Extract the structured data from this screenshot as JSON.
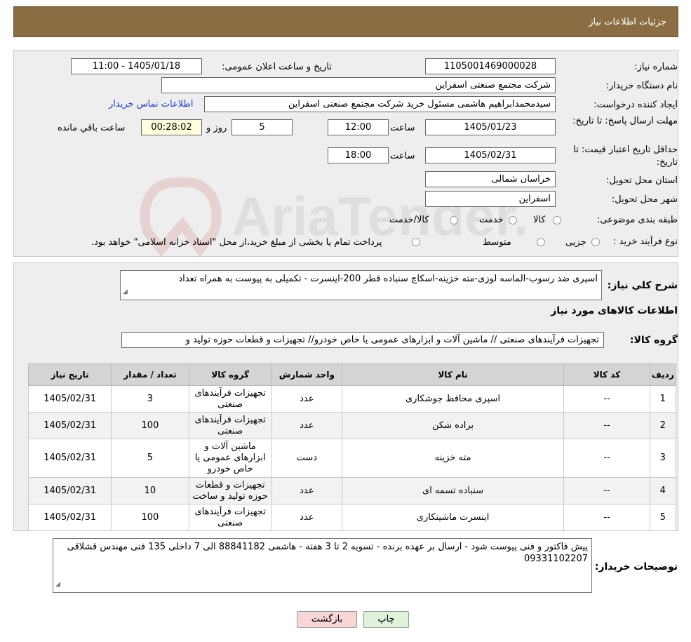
{
  "header": {
    "title": "جزئیات اطلاعات نیاز"
  },
  "form": {
    "need_number_label": "شماره نیاز:",
    "need_number": "1105001469000028",
    "announce_label": "تاریخ و ساعت اعلان عمومی:",
    "announce_value": "1405/01/18 - 11:00",
    "buyer_org_label": "نام دستگاه خریدار:",
    "buyer_org": "شرکت مجتمع صنعتی اسفراین",
    "requester_label": "ایجاد کننده درخواست:",
    "requester": "سیدمحمدابراهیم هاشمی مسئول خرید شرکت مجتمع صنعتی اسفراین",
    "contact_link": "اطلاعات تماس خریدار",
    "deadline_label": "مهلت ارسال پاسخ: تا تاریخ:",
    "deadline_date": "1405/01/23",
    "time_label": "ساعت",
    "deadline_time": "12:00",
    "days_value": "5",
    "days_label": "روز و",
    "remaining_time": "00:28:02",
    "remaining_label": "ساعت باقي مانده",
    "validity_label": "حداقل تاریخ اعتبار قیمت: تا تاریخ:",
    "validity_date": "1405/02/31",
    "validity_time": "18:00",
    "province_label": "استان محل تحویل:",
    "province": "خراسان شمالی",
    "city_label": "شهر محل تحویل:",
    "city": "اسفراین",
    "category_label": "طبقه بندی موضوعی:",
    "category_options": [
      "کالا",
      "خدمت",
      "کالا/خدمت"
    ],
    "process_label": "نوع فرآیند خرید :",
    "process_options": [
      "جزیی",
      "متوسط"
    ],
    "process_note": "پرداخت تمام یا بخشی از مبلغ خرید،از محل \"اسناد خزانه اسلامی\" خواهد بود."
  },
  "summary": {
    "desc_label": "شرح كلي نياز:",
    "desc_text": "اسپری ضد رسوب-الماسه لوزی-مته خزینه-اسکاچ سنباده قطر 200-اینسرت - تکمیلی به پیوست به همراه تعداد",
    "goods_info_title": "اطلاعات کالاهای مورد نیاز",
    "goods_group_label": "گروه کالا:",
    "goods_group_value": "تجهیزات فرآیندهای صنعتی //  ماشین آلات و ابزارهای عمومی یا خاص خودرو// تجهیزات و قطعات حوزه تولید و"
  },
  "table": {
    "headers": [
      "ردیف",
      "کد کالا",
      "نام کالا",
      "واحد شمارش",
      "گروه کالا",
      "تعداد / مقدار",
      "تاریخ نیاز"
    ],
    "rows": [
      {
        "n": "1",
        "code": "--",
        "name": "اسپری محافظ جوشکاری",
        "unit": "عدد",
        "group": "تجهیزات فرآیندهای صنعتی",
        "qty": "3",
        "date": "1405/02/31"
      },
      {
        "n": "2",
        "code": "--",
        "name": "براده شکن",
        "unit": "عدد",
        "group": "تجهیزات فرآیندهای صنعتی",
        "qty": "100",
        "date": "1405/02/31"
      },
      {
        "n": "3",
        "code": "--",
        "name": "مته خزینه",
        "unit": "دست",
        "group": "ماشین آلات و ابزارهای عمومی یا خاص خودرو",
        "qty": "5",
        "date": "1405/02/31"
      },
      {
        "n": "4",
        "code": "--",
        "name": "سنباده تسمه ای",
        "unit": "عدد",
        "group": "تجهیزات و قطعات حوزه تولید و ساخت",
        "qty": "10",
        "date": "1405/02/31"
      },
      {
        "n": "5",
        "code": "--",
        "name": "اینسرت ماشینکاری",
        "unit": "عدد",
        "group": "تجهیزات فرآیندهای صنعتی",
        "qty": "100",
        "date": "1405/02/31"
      }
    ]
  },
  "buyer_notes": {
    "label": "توضیحات خریدار:",
    "text": "پیش فاکتور و فنی پیوست شود - ارسال بر عهده برنده - تسویه 2 تا 3 هفته - هاشمی 88841182 الی 7 داخلی 135 فنی مهندس قشلاقی 09331102207"
  },
  "buttons": {
    "print": "چاپ",
    "back": "بازگشت"
  },
  "watermark_text": "AriaTender.neT",
  "colors": {
    "header_bg": "#8b6d43",
    "link": "#1f3fd3",
    "panel": "#eeeeee",
    "back_button": "#f7d6d6",
    "print_button": "#dff2da"
  }
}
